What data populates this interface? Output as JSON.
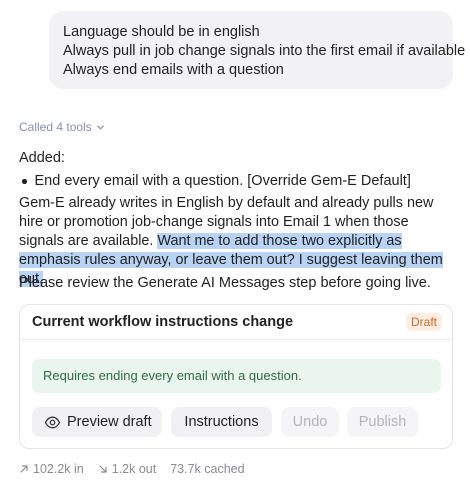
{
  "user_message": {
    "lines": [
      "Language should be in english",
      "Always pull in job change signals into the first email if available",
      "Always end emails with a question"
    ]
  },
  "tools": {
    "label": "Called 4 tools",
    "icon": "chevron-down-icon"
  },
  "response": {
    "added_label": "Added:",
    "bullet": "End every email with a question. [Override Gem-E Default]",
    "para_plain": "Gem-E already writes in English by default and already pulls new hire or promotion job-change signals into Email 1 when those signals are available. ",
    "para_highlight": "Want me to add those two explicitly as emphasis rules anyway, or leave them out? I suggest leaving them out.",
    "review": "Please review the Generate AI Messages step before going live."
  },
  "card": {
    "title": "Current workflow instructions change",
    "badge": "Draft",
    "note": "Requires ending every email with a question.",
    "buttons": {
      "preview": "Preview draft",
      "instructions": "Instructions",
      "undo": "Undo",
      "publish": "Publish"
    }
  },
  "usage": {
    "in": "102.2k in",
    "out": "1.2k out",
    "cached": "73.7k cached"
  },
  "colors": {
    "highlight": "#b9d3f5",
    "draft_badge": "#c66a2c",
    "note_bg": "#eaf5ee",
    "note_text": "#2f6b45"
  }
}
